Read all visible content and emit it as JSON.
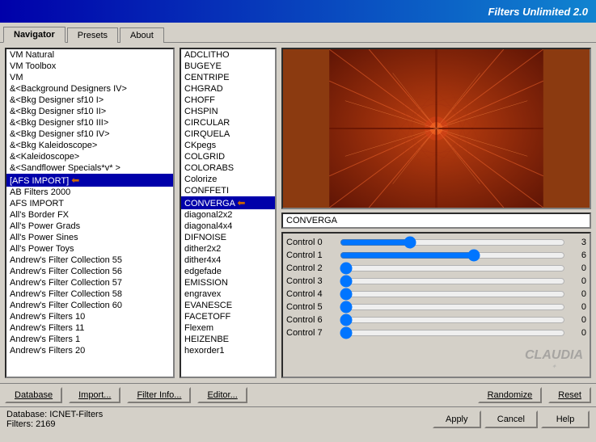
{
  "titleBar": {
    "text": "Filters Unlimited 2.0"
  },
  "tabs": [
    {
      "id": "navigator",
      "label": "Navigator",
      "active": true
    },
    {
      "id": "presets",
      "label": "Presets",
      "active": false
    },
    {
      "id": "about",
      "label": "About",
      "active": false
    }
  ],
  "leftList": {
    "items": [
      {
        "label": "VM Natural",
        "selected": false
      },
      {
        "label": "VM Toolbox",
        "selected": false
      },
      {
        "label": "VM",
        "selected": false
      },
      {
        "label": "&<Background Designers IV>",
        "selected": false
      },
      {
        "label": "&<Bkg Designer sf10 I>",
        "selected": false
      },
      {
        "label": "&<Bkg Designer sf10 II>",
        "selected": false
      },
      {
        "label": "&<Bkg Designer sf10 III>",
        "selected": false
      },
      {
        "label": "&<Bkg Designer sf10 IV>",
        "selected": false
      },
      {
        "label": "&<Bkg Kaleidoscope>",
        "selected": false
      },
      {
        "label": "&<Kaleidoscope>",
        "selected": false
      },
      {
        "label": "&<Sandflower Specials*v* >",
        "selected": false
      },
      {
        "label": "[AFS IMPORT]",
        "selected": true,
        "arrow": true
      },
      {
        "label": "AB Filters 2000",
        "selected": false
      },
      {
        "label": "AFS IMPORT",
        "selected": false
      },
      {
        "label": "All's Border FX",
        "selected": false
      },
      {
        "label": "All's Power Grads",
        "selected": false
      },
      {
        "label": "All's Power Sines",
        "selected": false
      },
      {
        "label": "All's Power Toys",
        "selected": false
      },
      {
        "label": "Andrew's Filter Collection 55",
        "selected": false
      },
      {
        "label": "Andrew's Filter Collection 56",
        "selected": false
      },
      {
        "label": "Andrew's Filter Collection 57",
        "selected": false
      },
      {
        "label": "Andrew's Filter Collection 58",
        "selected": false
      },
      {
        "label": "Andrew's Filter Collection 60",
        "selected": false
      },
      {
        "label": "Andrew's Filters 10",
        "selected": false
      },
      {
        "label": "Andrew's Filters 11",
        "selected": false
      },
      {
        "label": "Andrew's Filters 1",
        "selected": false
      },
      {
        "label": "Andrew's Filters 20",
        "selected": false
      }
    ]
  },
  "middleList": {
    "items": [
      {
        "label": "ADCLITHO",
        "selected": false
      },
      {
        "label": "BUGEYE",
        "selected": false
      },
      {
        "label": "CENTRIPE",
        "selected": false
      },
      {
        "label": "CHGRAD",
        "selected": false
      },
      {
        "label": "CHOFF",
        "selected": false
      },
      {
        "label": "CHSPIN",
        "selected": false
      },
      {
        "label": "CIRCULAR",
        "selected": false
      },
      {
        "label": "CIRQUELA",
        "selected": false
      },
      {
        "label": "CKpegs",
        "selected": false
      },
      {
        "label": "COLGRID",
        "selected": false
      },
      {
        "label": "COLORABS",
        "selected": false
      },
      {
        "label": "Colorize",
        "selected": false
      },
      {
        "label": "CONFFETI",
        "selected": false
      },
      {
        "label": "CONVERGA",
        "selected": true,
        "arrow": true
      },
      {
        "label": "diagonal2x2",
        "selected": false
      },
      {
        "label": "diagonal4x4",
        "selected": false
      },
      {
        "label": "DIFNOISE",
        "selected": false
      },
      {
        "label": "dither2x2",
        "selected": false
      },
      {
        "label": "dither4x4",
        "selected": false
      },
      {
        "label": "edgefade",
        "selected": false
      },
      {
        "label": "EMISSION",
        "selected": false
      },
      {
        "label": "engravex",
        "selected": false
      },
      {
        "label": "EVANESCE",
        "selected": false
      },
      {
        "label": "FACETOFF",
        "selected": false
      },
      {
        "label": "Flexem",
        "selected": false
      },
      {
        "label": "HEIZENBE",
        "selected": false
      },
      {
        "label": "hexorder1",
        "selected": false
      }
    ]
  },
  "filterNameDisplay": "CONVERGA",
  "controls": [
    {
      "label": "Control 0",
      "value": 3
    },
    {
      "label": "Control 1",
      "value": 6
    },
    {
      "label": "Control 2",
      "value": 0
    },
    {
      "label": "Control 3",
      "value": 0
    },
    {
      "label": "Control 4",
      "value": 0
    },
    {
      "label": "Control 5",
      "value": 0
    },
    {
      "label": "Control 6",
      "value": 0
    },
    {
      "label": "Control 7",
      "value": 0
    }
  ],
  "watermark": "CLAUDIA",
  "actionBar": {
    "buttons": [
      {
        "id": "database",
        "label": "Database"
      },
      {
        "id": "import",
        "label": "Import..."
      },
      {
        "id": "filter-info",
        "label": "Filter Info..."
      },
      {
        "id": "editor",
        "label": "Editor..."
      }
    ],
    "rightButtons": [
      {
        "id": "randomize",
        "label": "Randomize"
      },
      {
        "id": "reset",
        "label": "Reset"
      }
    ]
  },
  "footer": {
    "database": "ICNET-Filters",
    "filters": "2169",
    "databaseLabel": "Database:",
    "filtersLabel": "Filters:",
    "buttons": [
      {
        "id": "apply",
        "label": "Apply"
      },
      {
        "id": "cancel",
        "label": "Cancel"
      },
      {
        "id": "help",
        "label": "Help"
      }
    ]
  }
}
